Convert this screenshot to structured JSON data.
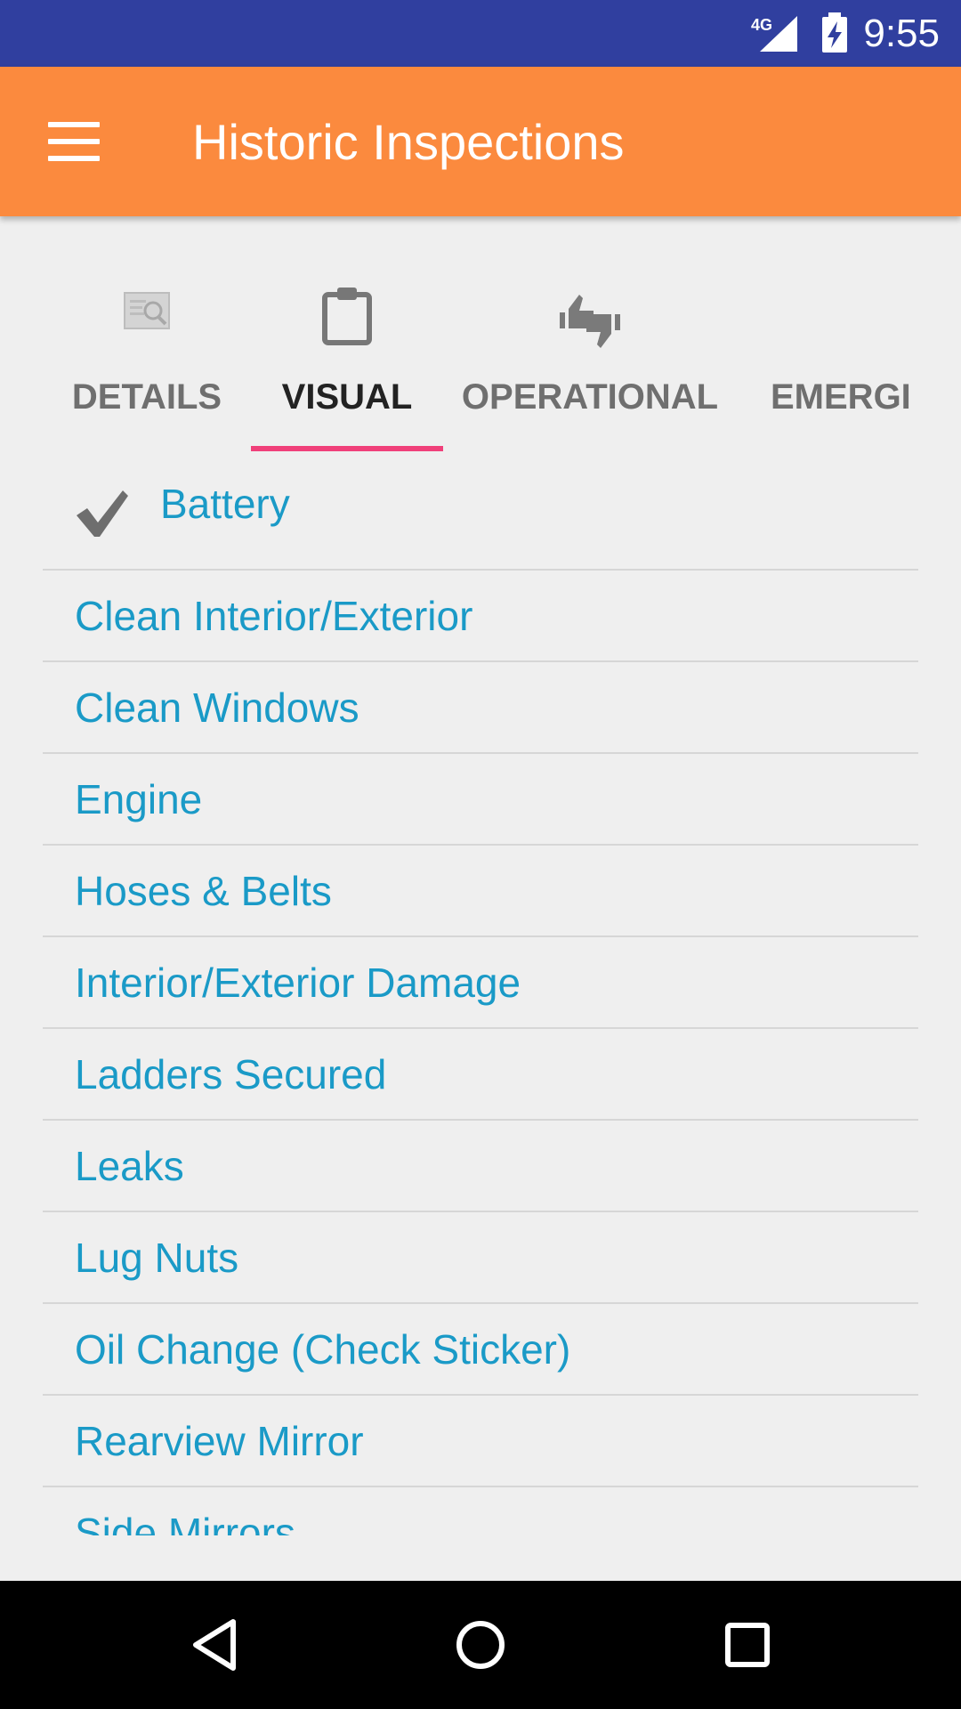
{
  "status_bar": {
    "network": "4G",
    "time": "9:55",
    "icons": [
      "signal-4g-icon",
      "battery-charging-icon"
    ]
  },
  "app_bar": {
    "title": "Historic Inspections",
    "icon": "menu-icon",
    "color": "#fb8a3e"
  },
  "tabs": [
    {
      "label": "DETAILS",
      "icon": "document-search-icon",
      "active": false
    },
    {
      "label": "VISUAL",
      "icon": "clipboard-icon",
      "active": true
    },
    {
      "label": "OPERATIONAL",
      "icon": "thumbs-up-down-icon",
      "active": false
    },
    {
      "label": "EMERGI",
      "icon": "",
      "active": false
    }
  ],
  "tab_indicator_color": "#f0407a",
  "checklist": {
    "first": {
      "label": "Battery",
      "checked": true,
      "icon": "check-icon"
    },
    "items": [
      "Clean Interior/Exterior",
      "Clean Windows",
      "Engine",
      "Hoses & Belts",
      "Interior/Exterior Damage",
      "Ladders Secured",
      "Leaks",
      "Lug Nuts",
      "Oil Change (Check Sticker)",
      "Rearview Mirror",
      "Side Mirrors"
    ],
    "text_color": "#1a9ac7"
  },
  "nav_bar": {
    "icons": [
      "back-icon",
      "home-icon",
      "recents-icon"
    ]
  }
}
